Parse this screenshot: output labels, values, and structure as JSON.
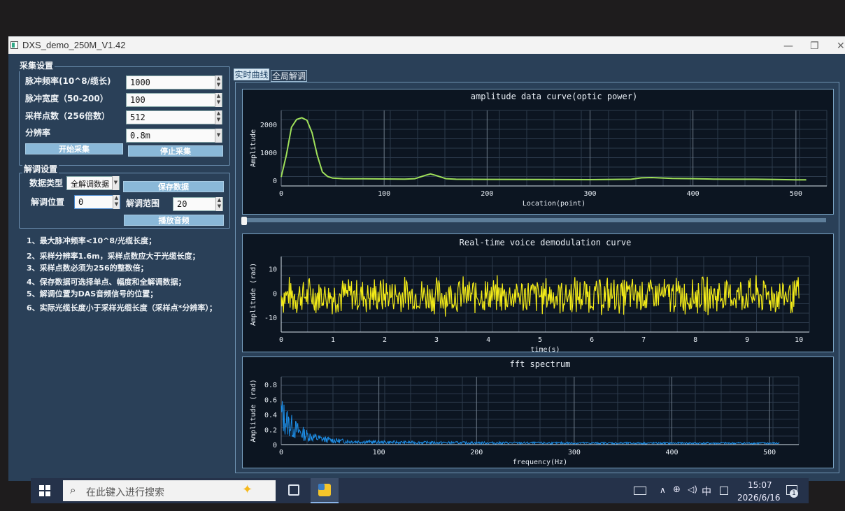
{
  "window": {
    "title": "DXS_demo_250M_V1.42"
  },
  "acquisition": {
    "title": "采集设置",
    "pulse_freq_label": "脉冲频率(10^8/缆长)",
    "pulse_freq_value": "1000",
    "pulse_width_label": "脉冲宽度（50-200）",
    "pulse_width_value": "100",
    "sample_points_label": "采样点数（256倍数）",
    "sample_points_value": "512",
    "resolution_label": "分辨率",
    "resolution_value": "0.8m",
    "start_button": "开始采集",
    "stop_button": "停止采集"
  },
  "demod": {
    "title": "解调设置",
    "data_type_label": "数据类型",
    "data_type_value": "全解调数据",
    "save_button": "保存数据",
    "position_label": "解调位置",
    "position_value": "0",
    "range_label": "解调范围",
    "range_value": "20",
    "play_button": "播放音频"
  },
  "notes": [
    "1、最大脉冲频率<10^8/光缆长度；",
    "2、采样分辨率1.6m，采样点数应大于光缆长度；",
    "3、采样点数必须为256的整数倍；",
    "4、保存数据可选择单点、幅度和全解调数据；",
    "5、解调位置为DAS音频信号的位置；",
    "6、实际光缆长度小于采样光缆长度（采样点*分辨率）；"
  ],
  "tabs": [
    {
      "label": "实时曲线"
    },
    {
      "label": "全局解调"
    }
  ],
  "colors": {
    "amp_line": "#9fe05a",
    "voice_line": "#f4ec18",
    "fft_line": "#1e8fe8",
    "window_bg": "#2a4058"
  },
  "chart_data": [
    {
      "type": "line",
      "title": "amplitude data curve(optic power)",
      "xlabel": "Location(point)",
      "ylabel": "Amplitude",
      "xlim": [
        0,
        530
      ],
      "ylim": [
        -200,
        2500
      ],
      "yticks": [
        "0",
        "1000",
        "2000"
      ],
      "xticks": [
        "0",
        "100",
        "200",
        "300",
        "400",
        "500"
      ],
      "series": [
        {
          "x": [
            0,
            5,
            10,
            15,
            20,
            25,
            30,
            35,
            40,
            45,
            50,
            60,
            80,
            100,
            120,
            130,
            140,
            145,
            150,
            160,
            170,
            200,
            250,
            300,
            340,
            350,
            360,
            380,
            400,
            420,
            440,
            460,
            480,
            500,
            510
          ],
          "y": [
            120,
            900,
            1900,
            2180,
            2240,
            2150,
            1700,
            900,
            300,
            140,
            80,
            60,
            55,
            50,
            45,
            60,
            180,
            230,
            180,
            60,
            40,
            35,
            30,
            25,
            40,
            90,
            100,
            70,
            60,
            45,
            40,
            40,
            30,
            20,
            20
          ]
        }
      ]
    },
    {
      "type": "line",
      "title": "Real-time voice demodulation curve",
      "xlabel": "time(s)",
      "ylabel": "Amplitude (rad)",
      "xlim": [
        0,
        10.2
      ],
      "ylim": [
        -16,
        15
      ],
      "yticks": [
        "10",
        "0",
        "-10"
      ],
      "xticks": [
        "0",
        "1",
        "2",
        "3",
        "4",
        "5",
        "6",
        "7",
        "8",
        "9",
        "10"
      ],
      "series": [
        {
          "note_style": "noise",
          "x_range": [
            0,
            10
          ],
          "amplitude_rad": 8
        }
      ]
    },
    {
      "type": "line",
      "title": "fft spectrum",
      "xlabel": "frequency(Hz)",
      "ylabel": "Amplitude (rad)",
      "xlim": [
        0,
        530
      ],
      "ylim": [
        0,
        0.9
      ],
      "yticks": [
        "0.8",
        "0.6",
        "0.4",
        "0.2",
        "0"
      ],
      "xticks": [
        "0",
        "100",
        "200",
        "300",
        "400",
        "500"
      ],
      "series": [
        {
          "x_range": [
            0,
            510
          ],
          "peak": 0.62,
          "floor": 0.03
        }
      ]
    }
  ],
  "taskbar": {
    "search_placeholder": "在此键入进行搜索",
    "time": "15:07",
    "date": "2026/6/16",
    "ime": "中",
    "notification_count": "1"
  }
}
